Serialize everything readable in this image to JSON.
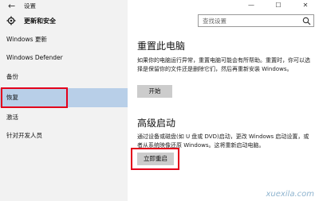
{
  "window": {
    "title": "设置",
    "back_icon": "back-arrow-icon",
    "controls": [
      "—",
      "☐",
      "✕"
    ]
  },
  "sidebar": {
    "header": "更新和安全",
    "header_icon": "gear-icon",
    "items": [
      {
        "label": "Windows 更新",
        "active": false
      },
      {
        "label": "Windows Defender",
        "active": false
      },
      {
        "label": "备份",
        "active": false
      },
      {
        "label": "恢复",
        "active": true
      },
      {
        "label": "激活",
        "active": false
      },
      {
        "label": "针对开发人员",
        "active": false
      }
    ]
  },
  "search": {
    "placeholder": "查找设置",
    "icon": "search-icon"
  },
  "reset": {
    "title": "重置此电脑",
    "description": "如果你的电脑运行异常，重置电脑可能会有所帮助。重置时，你可以选择是保留你的文件还是删除它们，然后再重新安装 Windows。",
    "button_label": "开始"
  },
  "advanced": {
    "title": "高级启动",
    "description": "通过设备或磁盘(如 U 盘或 DVD)启动，更改 Windows 启动设置，或者从系统映像还原 Windows。这将重新启动电脑。",
    "button_label": "立即重启"
  },
  "watermark": "xuexila.com",
  "colors": {
    "sidebar_bg": "#f2f2f2",
    "active_item": "#b8cfe8",
    "highlight_box": "#e3001b",
    "button_bg": "#cccccc"
  }
}
